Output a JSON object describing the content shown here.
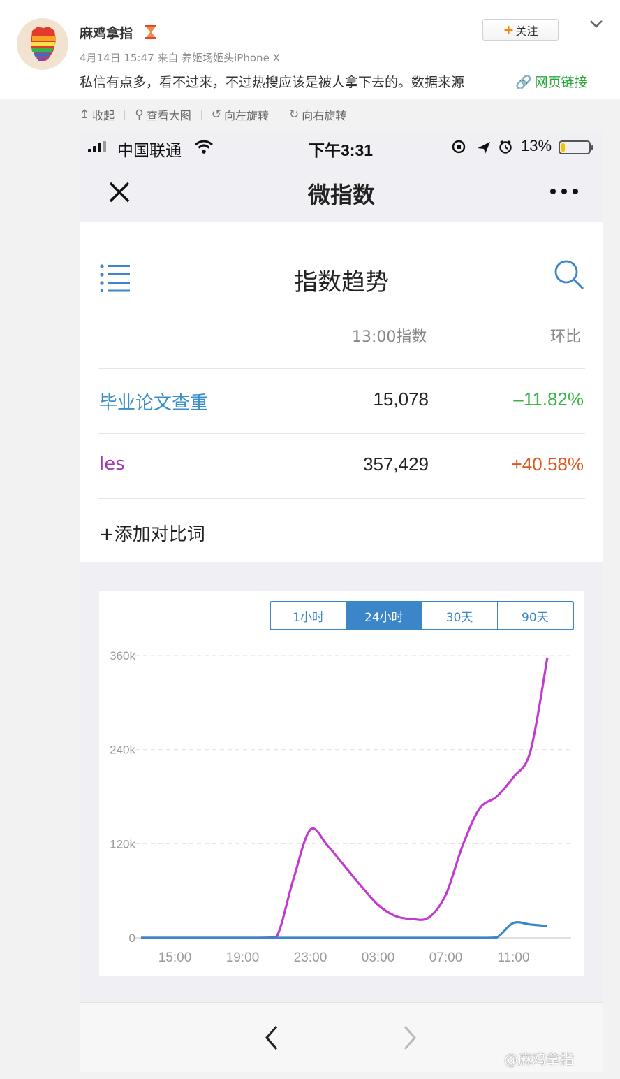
{
  "post": {
    "user_name": "麻鸡拿指",
    "meta": "4月14日 15:47 来自 养姬场姬头iPhone X",
    "text": "私信有点多，看不过来，不过热搜应该是被人拿下去的。数据来源",
    "link_label": "网页链接",
    "follow_label": "关注",
    "follow_plus": "+"
  },
  "picture_toolbar": {
    "items": [
      {
        "icon": "↥",
        "label": "收起"
      },
      {
        "icon": "⚲",
        "label": "查看大图"
      },
      {
        "icon": "↺",
        "label": "向左旋转"
      },
      {
        "icon": "↻",
        "label": "向右旋转"
      }
    ]
  },
  "phone": {
    "status": {
      "carrier": "中国联通",
      "time": "下午3:31",
      "battery": "13%",
      "battery_level": 0.13
    },
    "nav_title": "微指数",
    "card_title": "指数趋势",
    "columns": {
      "index": "13:00指数",
      "change": "环比"
    },
    "rows": [
      {
        "keyword": "毕业论文查重",
        "value": "15,078",
        "change": "–11.82%",
        "keyword_color": "#3a8fc8",
        "change_color": "#3cb34a"
      },
      {
        "keyword": "les",
        "value": "357,429",
        "change": "+40.58%",
        "keyword_color": "#a03bb4",
        "change_color": "#e2571e"
      }
    ],
    "add_word": "+添加对比词",
    "tabs": [
      "1小时",
      "24小时",
      "30天",
      "90天"
    ],
    "active_tab": "24小时"
  },
  "chart_data": {
    "type": "line",
    "title": "",
    "xlabel": "",
    "ylabel": "",
    "x_ticks": [
      "15:00",
      "19:00",
      "23:00",
      "03:00",
      "07:00",
      "11:00"
    ],
    "y_ticks": [
      "0",
      "120k",
      "240k",
      "360k"
    ],
    "ylim": [
      0,
      360000
    ],
    "grid": "dashed horizontal",
    "x": [
      "13:00",
      "14:00",
      "15:00",
      "16:00",
      "17:00",
      "18:00",
      "19:00",
      "20:00",
      "21:00",
      "22:00",
      "23:00",
      "00:00",
      "01:00",
      "02:00",
      "03:00",
      "04:00",
      "05:00",
      "06:00",
      "07:00",
      "08:00",
      "09:00",
      "10:00",
      "11:00",
      "12:00",
      "13:00"
    ],
    "series": [
      {
        "color": "#c13bd0",
        "values": [
          0,
          0,
          0,
          0,
          0,
          0,
          0,
          0,
          1000,
          75000,
          138000,
          118000,
          92000,
          66000,
          42000,
          28000,
          24000,
          26000,
          55000,
          118000,
          165000,
          180000,
          205000,
          238000,
          357429
        ]
      },
      {
        "color": "#3a86c8",
        "values": [
          0,
          0,
          0,
          0,
          0,
          0,
          0,
          0,
          0,
          0,
          0,
          0,
          0,
          0,
          0,
          0,
          0,
          0,
          0,
          0,
          0,
          500,
          19000,
          17000,
          15078
        ]
      }
    ]
  },
  "watermark": "@麻鸡拿指"
}
